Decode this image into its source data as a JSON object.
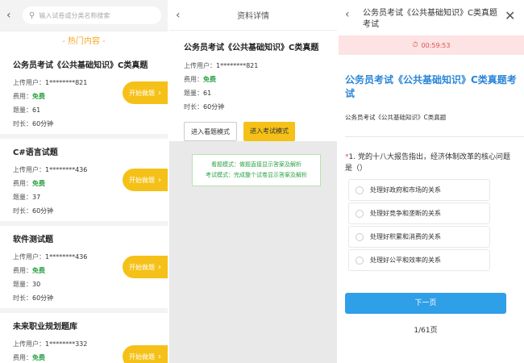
{
  "list_screen": {
    "search_placeholder": "输入试卷或分类名称搜索",
    "hot_title": "- 热门内容 -",
    "start_label": "开始做题",
    "labels": {
      "uploader": "上传用户：",
      "fee": "费用：",
      "count": "题量：",
      "duration": "时长："
    },
    "items": [
      {
        "title": "公务员考试《公共基础知识》C类真题",
        "uploader": "1********821",
        "fee": "免费",
        "count": "61",
        "duration": "60分钟"
      },
      {
        "title": "C#语言试题",
        "uploader": "1********436",
        "fee": "免费",
        "count": "37",
        "duration": "60分钟"
      },
      {
        "title": "软件测试题",
        "uploader": "1********436",
        "fee": "免费",
        "count": "30",
        "duration": "60分钟"
      },
      {
        "title": "未来职业规划题库",
        "uploader": "1********332",
        "fee": "免费",
        "count": "",
        "duration": ""
      }
    ]
  },
  "detail_screen": {
    "header_title": "资料详情",
    "title": "公务员考试《公共基础知识》C类真题",
    "uploader_label": "上传用户：",
    "uploader": "1********821",
    "fee_label": "费用：",
    "fee": "免费",
    "count_label": "题量：",
    "count": "61",
    "duration_label": "时长：",
    "duration": "60分钟",
    "browse_mode_button": "进入看题模式",
    "exam_mode_button": "进入考试模式",
    "tip_browse": "看题模式：做题直接显示答案及解析",
    "tip_exam": "考试模式：完成整个试卷显示答案及解析"
  },
  "exam_screen": {
    "header_title": "公务员考试《公共基础知识》C类真题考试",
    "timer": "00:59:53",
    "exam_title": "公务员考试《公共基础知识》C类真题考试",
    "exam_subtitle": "公务员考试《公共基础知识》C类真题",
    "question_marker": "*",
    "question_text": "1. 党的十八大报告指出，经济体制改革的核心问题是（）",
    "options": [
      "处理好政府和市场的关系",
      "处理好竞争和垄断的关系",
      "处理好积累和消费的关系",
      "处理好公平和效率的关系"
    ],
    "next_button": "下一页",
    "pager": "1/61页"
  },
  "colors": {
    "accent_yellow": "#f5c118",
    "accent_blue": "#2a86d8",
    "free_green": "#2ba245",
    "timer_red": "#e05050"
  }
}
